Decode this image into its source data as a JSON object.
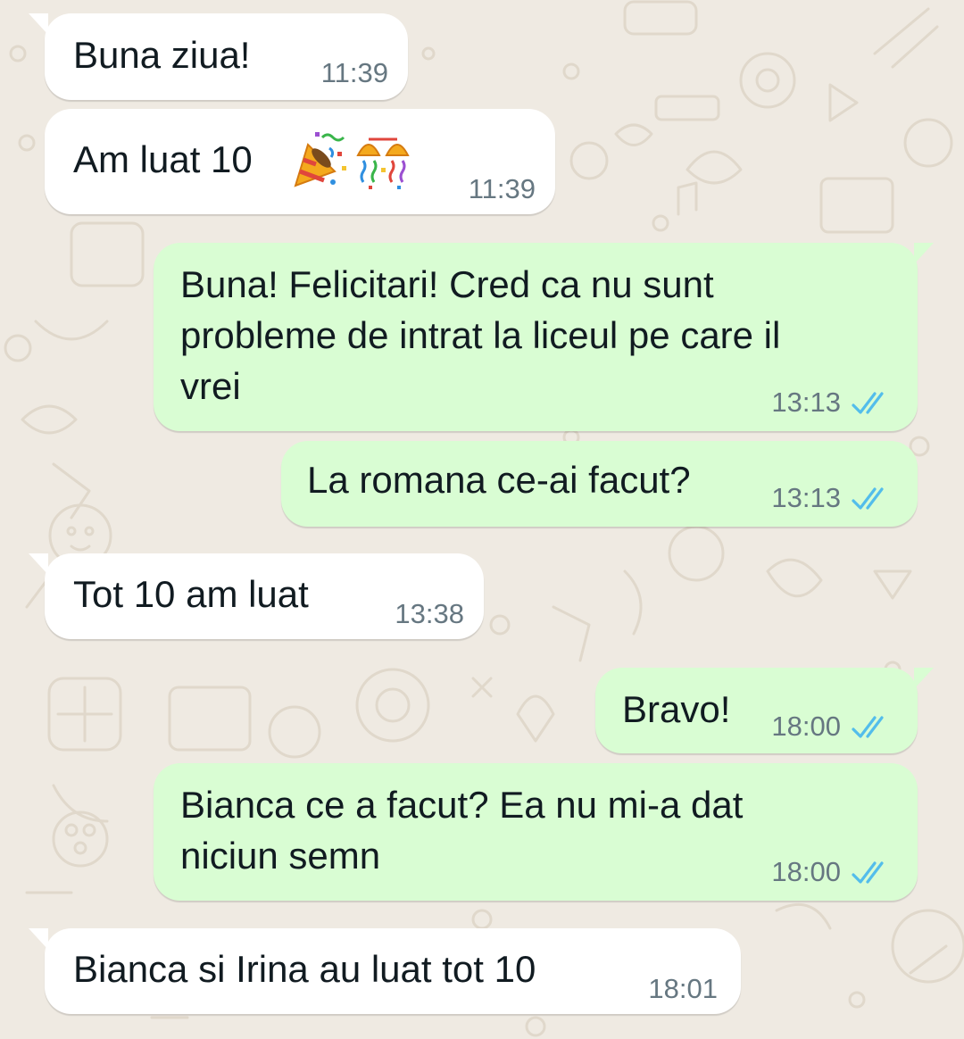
{
  "theme": {
    "incoming_bg": "#ffffff",
    "outgoing_bg": "#d9fdd3",
    "wallpaper_bg": "#efeae2",
    "text_color": "#111b21",
    "time_color": "#667781",
    "read_tick_color": "#53bdeb"
  },
  "messages": [
    {
      "direction": "incoming",
      "text": "Buna ziua!",
      "time": "11:39"
    },
    {
      "direction": "incoming",
      "text": "Am luat 10",
      "emoji": [
        "party-popper-icon",
        "confetti-ball-icon"
      ],
      "time": "11:39"
    },
    {
      "direction": "outgoing",
      "text": "Buna! Felicitari! Cred ca nu sunt\nprobleme de intrat la liceul pe care il\nvrei",
      "time": "13:13",
      "status": "read"
    },
    {
      "direction": "outgoing",
      "text": "La romana ce-ai facut?",
      "time": "13:13",
      "status": "read"
    },
    {
      "direction": "incoming",
      "text": "Tot 10 am luat",
      "time": "13:38"
    },
    {
      "direction": "outgoing",
      "text": "Bravo!",
      "time": "18:00",
      "status": "read"
    },
    {
      "direction": "outgoing",
      "text": "Bianca ce a facut? Ea nu mi-a dat\nniciun semn",
      "time": "18:00",
      "status": "read"
    },
    {
      "direction": "incoming",
      "text": "Bianca si Irina au luat tot 10",
      "time": "18:01"
    }
  ]
}
